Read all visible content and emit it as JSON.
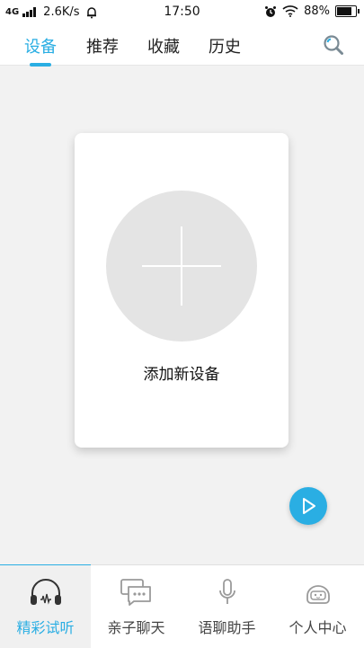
{
  "status_bar": {
    "network": "4G",
    "speed": "2.6K/s",
    "time": "17:50",
    "battery": "88%",
    "battery_level": 0.88
  },
  "tabs": [
    {
      "label": "设备",
      "active": true
    },
    {
      "label": "推荐",
      "active": false
    },
    {
      "label": "收藏",
      "active": false
    },
    {
      "label": "历史",
      "active": false
    }
  ],
  "search_icon": "search-icon",
  "device_card": {
    "add_label": "添加新设备",
    "icon": "plus-icon"
  },
  "fab_icon": "play-icon",
  "bottom_nav": [
    {
      "label": "精彩试听",
      "icon": "headphones-icon",
      "active": true
    },
    {
      "label": "亲子聊天",
      "icon": "chat-bubble-icon",
      "active": false
    },
    {
      "label": "语聊助手",
      "icon": "microphone-icon",
      "active": false
    },
    {
      "label": "个人中心",
      "icon": "robot-face-icon",
      "active": false
    }
  ],
  "colors": {
    "accent": "#2aaee3",
    "background": "#f2f2f2",
    "circle": "#e4e4e4"
  }
}
